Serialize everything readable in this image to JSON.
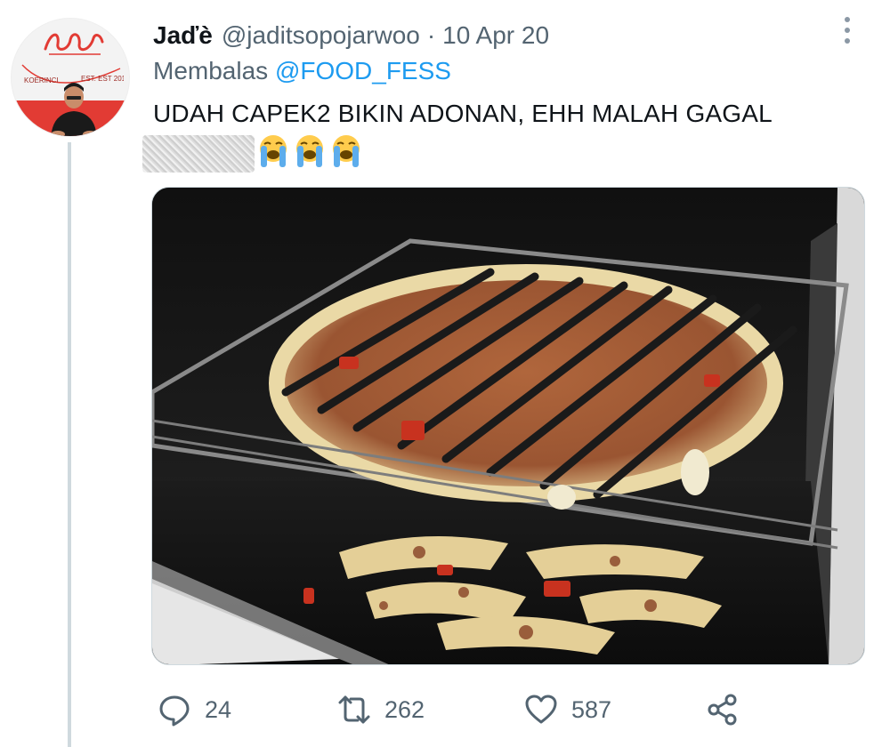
{
  "tweet": {
    "author_name": "Jaďè",
    "handle": "@jaditsopojarwoo",
    "separator": "·",
    "date": "10 Apr 20",
    "reply_prefix": "Membalas",
    "reply_mention": "@FOOD_FESS",
    "text": "UDAH CAPEK2 BIKIN ADONAN, EHH MALAH GAGAL",
    "emojis": [
      "loudly-crying-face",
      "loudly-crying-face",
      "loudly-crying-face"
    ]
  },
  "avatar": {
    "ring_text_left": "KOERINCI",
    "ring_text_right": "EST. EST 2018"
  },
  "actions": {
    "reply_count": "24",
    "retweet_count": "262",
    "like_count": "587"
  },
  "icons": {
    "more": "more-vertical-icon",
    "reply": "reply-icon",
    "retweet": "retweet-icon",
    "like": "heart-icon",
    "share": "share-icon"
  },
  "colors": {
    "text_primary": "#0f1419",
    "text_secondary": "#536471",
    "link": "#1d9bf0",
    "thread_line": "#cfd9de"
  }
}
